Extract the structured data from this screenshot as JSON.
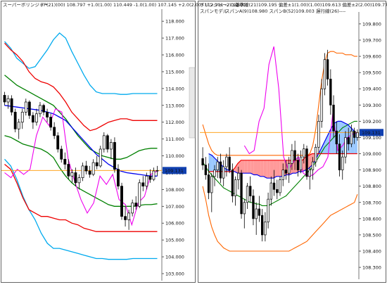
{
  "chart_data": [
    {
      "type": "candlestick",
      "title": "スーパーボリンジャー",
      "params_text": "TP(21)(00) 108.797 +1.0(1.00) 110.449 -1.0(1.00) 107.145 +2.0(2.00) 112.101 -2.0(2.00)",
      "ylim": [
        103,
        118.3
      ],
      "yticks": [
        "118.000",
        "117.000",
        "116.000",
        "115.000",
        "114.000",
        "113.000",
        "112.000",
        "111.000",
        "110.000",
        "109.000",
        "108.000",
        "107.000",
        "106.000",
        "105.000",
        "104.000",
        "103.000"
      ],
      "price_tag": "109.131",
      "colors": {
        "up": "#ffffff",
        "down": "#000000",
        "mid": "#0000ee",
        "sigma1": "#008000",
        "sigma2": "#ee0000",
        "sigma3": "#00aaee",
        "chikou": "#ee00ee",
        "price": "#ff9900"
      },
      "candles": [
        [
          113.6,
          113.8,
          113.0,
          113.2
        ],
        [
          113.2,
          113.6,
          112.8,
          113.4
        ],
        [
          113.4,
          113.6,
          112.4,
          112.6
        ],
        [
          112.6,
          112.8,
          111.4,
          111.6
        ],
        [
          111.6,
          112.2,
          111.0,
          112.0
        ],
        [
          112.0,
          112.8,
          111.6,
          112.6
        ],
        [
          112.6,
          113.4,
          112.4,
          113.2
        ],
        [
          113.2,
          113.3,
          112.2,
          112.4
        ],
        [
          112.4,
          112.6,
          111.6,
          112.0
        ],
        [
          112.0,
          112.8,
          111.8,
          112.5
        ],
        [
          112.5,
          113.2,
          112.3,
          113.0
        ],
        [
          113.0,
          113.1,
          112.4,
          112.6
        ],
        [
          112.6,
          112.8,
          112.0,
          112.3
        ],
        [
          112.3,
          112.5,
          111.5,
          111.7
        ],
        [
          111.7,
          112.0,
          111.0,
          111.2
        ],
        [
          111.2,
          111.4,
          110.2,
          110.4
        ],
        [
          110.4,
          110.6,
          109.6,
          109.8
        ],
        [
          109.8,
          110.2,
          109.2,
          109.5
        ],
        [
          109.5,
          109.8,
          108.6,
          108.8
        ],
        [
          108.8,
          109.2,
          108.4,
          109.0
        ],
        [
          109.0,
          109.3,
          108.2,
          108.4
        ],
        [
          108.4,
          108.9,
          108.0,
          108.7
        ],
        [
          108.7,
          109.6,
          108.5,
          109.4
        ],
        [
          109.4,
          109.7,
          108.9,
          109.1
        ],
        [
          109.1,
          109.4,
          108.7,
          108.9
        ],
        [
          108.9,
          109.8,
          108.8,
          109.6
        ],
        [
          109.6,
          110.0,
          109.2,
          109.4
        ],
        [
          109.4,
          110.6,
          109.3,
          110.4
        ],
        [
          110.4,
          111.4,
          110.2,
          111.2
        ],
        [
          111.2,
          111.3,
          110.2,
          110.4
        ],
        [
          110.4,
          111.0,
          109.8,
          110.8
        ],
        [
          110.8,
          111.1,
          109.0,
          109.2
        ],
        [
          109.2,
          109.5,
          108.0,
          108.2
        ],
        [
          108.2,
          108.4,
          106.2,
          106.4
        ],
        [
          106.4,
          107.0,
          105.8,
          106.2
        ],
        [
          106.2,
          106.8,
          105.6,
          106.6
        ],
        [
          106.6,
          107.4,
          106.4,
          107.2
        ],
        [
          107.2,
          107.6,
          106.8,
          107.0
        ],
        [
          107.0,
          108.6,
          106.9,
          108.4
        ],
        [
          108.4,
          108.8,
          107.9,
          108.2
        ],
        [
          108.2,
          109.0,
          108.0,
          108.8
        ],
        [
          108.8,
          109.2,
          108.4,
          108.6
        ],
        [
          108.6,
          109.3,
          108.5,
          109.1
        ],
        [
          109.1,
          109.4,
          108.8,
          109.13
        ]
      ],
      "mid_band": [
        113.0,
        112.95,
        112.9,
        112.85,
        112.8,
        112.75,
        112.7,
        112.6,
        112.5,
        112.3,
        112.1,
        111.7,
        111.3,
        110.9,
        110.5,
        110.1,
        109.8,
        109.5,
        109.3,
        109.1,
        109.0,
        108.95,
        108.9,
        108.85,
        108.8,
        108.8
      ],
      "upper1_band": [
        114.8,
        114.5,
        114.2,
        114.0,
        113.8,
        113.6,
        113.4,
        113.2,
        113.0,
        112.6,
        112.2,
        111.7,
        111.2,
        110.8,
        110.4,
        110.2,
        110.0,
        109.9,
        109.8,
        109.8,
        109.9,
        110.1,
        110.3,
        110.4,
        110.45,
        110.45
      ],
      "lower1_band": [
        111.2,
        111.1,
        110.9,
        110.7,
        110.6,
        110.5,
        110.4,
        110.2,
        109.9,
        109.3,
        108.8,
        108.4,
        108.1,
        107.9,
        107.7,
        107.5,
        107.3,
        107.1,
        107.0,
        107.0,
        107.0,
        107.0,
        107.05,
        107.1,
        107.1,
        107.15
      ],
      "upper2_band": [
        116.7,
        116.3,
        116.0,
        115.6,
        115.0,
        114.6,
        114.4,
        114.3,
        114.1,
        113.7,
        113.2,
        112.6,
        112.2,
        111.8,
        111.5,
        111.6,
        111.8,
        112.0,
        112.1,
        112.2,
        112.2,
        112.1,
        112.1,
        112.1,
        112.1,
        112.1
      ],
      "lower2_band": [
        109.5,
        109.2,
        108.4,
        107.5,
        106.8,
        106.6,
        106.4,
        106.4,
        106.3,
        106.2,
        106.2,
        106.0,
        105.9,
        105.7,
        105.6,
        105.5,
        105.5,
        105.5,
        105.5,
        105.5,
        105.5,
        105.5,
        105.5,
        105.5,
        105.5,
        105.5
      ],
      "upper3_band": [
        116.8,
        116.4,
        115.8,
        115.5,
        115.2,
        115.3,
        115.8,
        116.3,
        116.9,
        117.3,
        117.0,
        116.2,
        115.5,
        114.8,
        114.2,
        113.8,
        113.7,
        113.7,
        113.7,
        113.65,
        113.65,
        113.7,
        113.7,
        113.7,
        113.7,
        113.7
      ],
      "lower3_band": [
        109.8,
        109.4,
        108.6,
        107.6,
        106.8,
        106.2,
        105.4,
        104.8,
        104.5,
        104.5,
        104.4,
        104.3,
        104.2,
        104.1,
        104.0,
        103.9,
        103.9,
        103.85,
        103.85,
        103.85,
        103.85,
        103.9,
        103.9,
        103.9,
        103.9,
        103.9
      ],
      "chikou_span": [
        109.0,
        108.7,
        109.2,
        108.9,
        109.2,
        111.2,
        112.3,
        111.8,
        112.8,
        112.6,
        109.8,
        108.5,
        107.4,
        106.6,
        107.2,
        108.8,
        108.3,
        108.9,
        107.4,
        107.1,
        105.9,
        107.2,
        107.6,
        108.9,
        109.1
      ]
    },
    {
      "type": "candlestick",
      "title": "ボリンジャーバンド",
      "params_text": "基準線(21)109.195 偏差±1(1.00)(1.00)109.613 偏差±2(2.00)109.776",
      "title2": "スパンモデル",
      "params_text2": "スパンA(9)108.980 スパンB(52)109.003 遅行線(26)----",
      "ylim": [
        108.27,
        109.83
      ],
      "yticks": [
        "109.800",
        "109.700",
        "109.600",
        "109.500",
        "109.400",
        "109.300",
        "109.200",
        "109.100",
        "109.000",
        "108.900",
        "108.800",
        "108.700",
        "108.600",
        "108.500",
        "108.400",
        "108.300"
      ],
      "price_tag": "109.131",
      "colors": {
        "up": "#ffffff",
        "down": "#000000",
        "spanA": "#0000ee",
        "spanB": "#ee0000",
        "cloud_up": "#9ac8ff",
        "cloud_down": "#ff9a9a",
        "bb": "#ff6600",
        "mid": "#008000",
        "chikou": "#ee00ee",
        "price": "#ff9900"
      },
      "candles": [
        [
          108.97,
          109.04,
          108.9,
          108.93
        ],
        [
          108.93,
          108.98,
          108.84,
          108.87
        ],
        [
          108.87,
          108.94,
          108.72,
          108.76
        ],
        [
          108.76,
          108.88,
          108.64,
          108.86
        ],
        [
          108.86,
          108.93,
          108.8,
          108.9
        ],
        [
          108.9,
          108.98,
          108.85,
          108.95
        ],
        [
          108.95,
          109.0,
          108.82,
          108.85
        ],
        [
          108.85,
          108.96,
          108.8,
          108.92
        ],
        [
          108.92,
          109.0,
          108.86,
          108.98
        ],
        [
          108.98,
          109.04,
          108.88,
          108.9
        ],
        [
          108.9,
          108.94,
          108.7,
          108.74
        ],
        [
          108.74,
          108.86,
          108.68,
          108.84
        ],
        [
          108.84,
          108.92,
          108.78,
          108.88
        ],
        [
          108.88,
          108.9,
          108.6,
          108.63
        ],
        [
          108.63,
          108.72,
          108.54,
          108.7
        ],
        [
          108.7,
          108.82,
          108.66,
          108.8
        ],
        [
          108.8,
          108.86,
          108.7,
          108.74
        ],
        [
          108.74,
          108.78,
          108.56,
          108.6
        ],
        [
          108.6,
          108.7,
          108.5,
          108.66
        ],
        [
          108.66,
          108.74,
          108.58,
          108.62
        ],
        [
          108.62,
          108.66,
          108.46,
          108.5
        ],
        [
          108.5,
          108.64,
          108.46,
          108.58
        ],
        [
          108.58,
          108.76,
          108.54,
          108.72
        ],
        [
          108.72,
          108.86,
          108.68,
          108.82
        ],
        [
          108.82,
          108.9,
          108.74,
          108.78
        ],
        [
          108.78,
          108.84,
          108.72,
          108.76
        ],
        [
          108.76,
          108.86,
          108.74,
          108.84
        ],
        [
          108.84,
          108.94,
          108.8,
          108.9
        ],
        [
          108.9,
          108.96,
          108.84,
          108.88
        ],
        [
          108.88,
          108.98,
          108.82,
          108.94
        ],
        [
          108.94,
          109.06,
          108.9,
          109.02
        ],
        [
          109.02,
          109.08,
          108.9,
          108.96
        ],
        [
          108.96,
          109.0,
          108.86,
          108.9
        ],
        [
          108.9,
          109.02,
          108.88,
          108.98
        ],
        [
          108.98,
          109.06,
          108.94,
          109.03
        ],
        [
          109.03,
          109.05,
          108.84,
          108.86
        ],
        [
          108.86,
          108.92,
          108.78,
          108.9
        ],
        [
          108.9,
          108.98,
          108.84,
          108.95
        ],
        [
          108.95,
          109.06,
          108.92,
          109.04
        ],
        [
          109.04,
          109.24,
          109.0,
          109.2
        ],
        [
          109.2,
          109.46,
          109.16,
          109.4
        ],
        [
          109.4,
          109.62,
          109.36,
          109.58
        ],
        [
          109.58,
          109.64,
          109.42,
          109.46
        ],
        [
          109.46,
          109.52,
          109.24,
          109.3
        ],
        [
          109.3,
          109.36,
          109.1,
          109.14
        ],
        [
          109.14,
          109.2,
          109.0,
          109.06
        ],
        [
          109.06,
          109.12,
          108.86,
          108.9
        ],
        [
          108.9,
          109.02,
          108.84,
          108.98
        ],
        [
          108.98,
          109.14,
          108.94,
          109.1
        ],
        [
          109.1,
          109.16,
          109.02,
          109.06
        ],
        [
          109.06,
          109.18,
          109.04,
          109.14
        ],
        [
          109.14,
          109.16,
          109.06,
          109.1
        ],
        [
          109.1,
          109.15,
          109.08,
          109.131
        ]
      ],
      "span_a": [
        109.0,
        108.99,
        108.97,
        108.95,
        108.93,
        108.91,
        108.9,
        108.89,
        108.89,
        108.88,
        108.88,
        108.88,
        108.88,
        108.88,
        108.87,
        108.87,
        108.86,
        108.86,
        108.85,
        108.85,
        108.85,
        108.86,
        108.86,
        108.86,
        108.87,
        108.87,
        108.88,
        108.88,
        108.89,
        108.89,
        108.9,
        108.91,
        108.93,
        108.96,
        109.0,
        109.04,
        109.08,
        109.12,
        109.16,
        109.19,
        109.2,
        109.2,
        109.19,
        109.18,
        109.16,
        109.14,
        109.12
      ],
      "span_b": [
        108.89,
        108.89,
        108.89,
        108.89,
        108.89,
        108.89,
        108.89,
        108.89,
        108.91,
        108.94,
        108.96,
        108.96,
        108.96,
        108.96,
        108.96,
        108.96,
        108.96,
        108.96,
        108.96,
        108.96,
        108.96,
        108.96,
        108.96,
        108.96,
        108.96,
        108.96,
        108.96,
        108.96,
        108.96,
        108.96,
        108.98,
        108.99,
        109.0,
        109.0,
        109.0,
        109.0,
        109.0,
        109.0,
        109.0,
        109.0,
        109.0,
        109.0,
        109.0,
        109.0,
        109.0,
        109.0,
        109.0
      ],
      "bb_upper": [
        109.18,
        109.12,
        109.06,
        109.02,
        109.0,
        108.99,
        108.99,
        108.99,
        108.99,
        108.99,
        108.99,
        108.99,
        108.99,
        108.99,
        108.99,
        108.99,
        108.99,
        108.99,
        108.99,
        108.99,
        108.99,
        108.99,
        108.99,
        108.99,
        108.99,
        108.99,
        108.99,
        108.99,
        108.99,
        108.99,
        108.99,
        108.99,
        108.99,
        108.99,
        108.99,
        108.99,
        109.0,
        109.05,
        109.15,
        109.3,
        109.45,
        109.56,
        109.62,
        109.63,
        109.63,
        109.62,
        109.62,
        109.62,
        109.61,
        109.61,
        109.61,
        109.6,
        109.6
      ],
      "bb_mid": [
        108.95,
        108.92,
        108.89,
        108.87,
        108.85,
        108.83,
        108.81,
        108.79,
        108.78,
        108.77,
        108.76,
        108.75,
        108.74,
        108.73,
        108.72,
        108.71,
        108.7,
        108.7,
        108.69,
        108.69,
        108.68,
        108.68,
        108.68,
        108.69,
        108.7,
        108.71,
        108.72,
        108.73,
        108.74,
        108.76,
        108.78,
        108.8,
        108.82,
        108.84,
        108.86,
        108.88,
        108.9,
        108.92,
        108.95,
        108.98,
        109.01,
        109.04,
        109.06,
        109.08,
        109.1,
        109.12,
        109.14,
        109.16,
        109.17,
        109.18,
        109.19,
        109.2,
        109.2
      ],
      "bb_lower": [
        108.8,
        108.72,
        108.62,
        108.55,
        108.5,
        108.46,
        108.44,
        108.42,
        108.41,
        108.4,
        108.4,
        108.4,
        108.4,
        108.4,
        108.4,
        108.4,
        108.4,
        108.4,
        108.4,
        108.4,
        108.4,
        108.4,
        108.4,
        108.4,
        108.4,
        108.4,
        108.4,
        108.4,
        108.4,
        108.4,
        108.41,
        108.42,
        108.43,
        108.44,
        108.45,
        108.46,
        108.48,
        108.5,
        108.52,
        108.54,
        108.56,
        108.58,
        108.6,
        108.62,
        108.63,
        108.64,
        108.65,
        108.66,
        108.67,
        108.68,
        108.69,
        108.7,
        108.75
      ],
      "chikou_span": [
        109.05,
        109.0,
        109.02,
        109.2,
        109.28,
        109.55,
        109.66,
        109.4,
        108.98,
        108.9,
        108.95,
        108.98,
        108.88,
        108.86,
        108.87,
        108.9,
        108.92,
        108.98,
        109.25,
        109.02,
        109.05,
        109.1,
        109.12,
        109.131
      ]
    }
  ]
}
